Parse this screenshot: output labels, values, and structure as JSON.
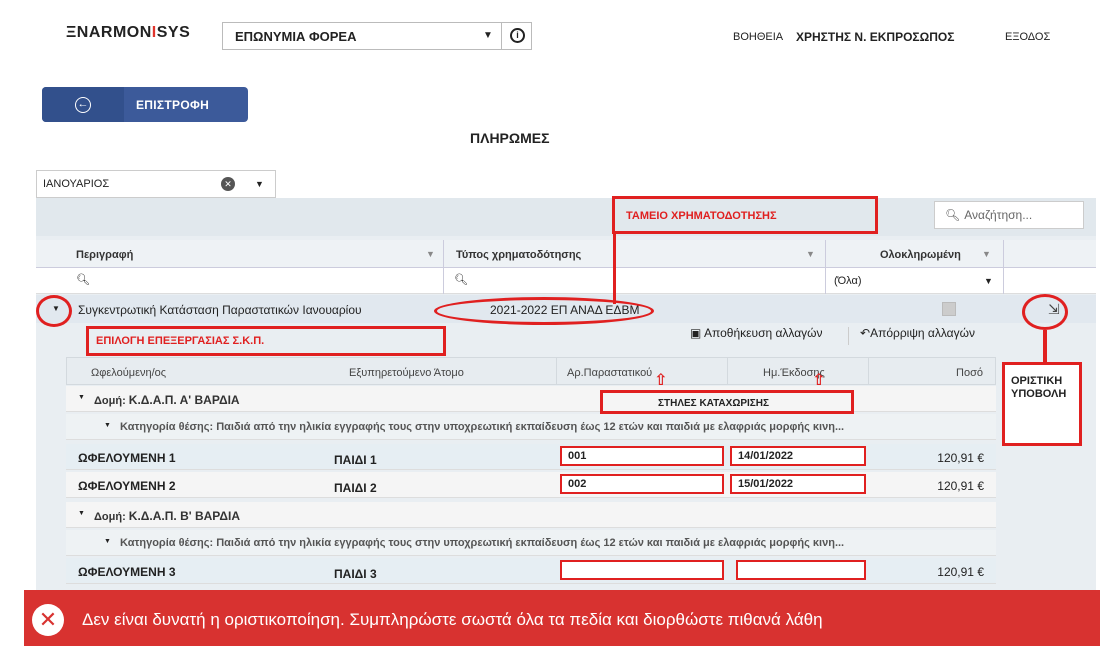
{
  "header": {
    "logo_pre": "ΞNARMON",
    "logo_o": "I",
    "logo_post": "SYS",
    "org_selector": "ΕΠΩΝΥΜΙΑ ΦΟΡΕΑ",
    "help": "ΒΟΗΘΕΙΑ",
    "user": "ΧΡΗΣΤΗΣ Ν. ΕΚΠΡΟΣΩΠΟΣ",
    "exit": "ΕΞΟΔΟΣ"
  },
  "back_button": {
    "label": "ΕΠΙΣΤΡΟΦΗ"
  },
  "page_title": "ΠΛΗΡΩΜΕΣ",
  "month_select": {
    "value": "ΙΑΝΟΥΑΡΙΟΣ"
  },
  "search": {
    "placeholder": "Αναζήτηση..."
  },
  "grid": {
    "columns": {
      "description": "Περιγραφή",
      "funding_type": "Τύπος χρηματοδότησης",
      "completed": "Ολοκληρωμένη"
    },
    "filter_all": "(Όλα)",
    "master_row": {
      "description": "Συγκεντρωτική Κατάσταση Παραστατικών Ιανουαρίου",
      "funding": "2021-2022 ΕΠ ΑΝΑΔ ΕΔΒΜ"
    }
  },
  "detail": {
    "save": "Αποθήκευση αλλαγών",
    "discard": "Απόρριψη αλλαγών",
    "columns": [
      "Ωφελούμενη/ος",
      "Εξυπηρετούμενο Άτομο",
      "Αρ.Παραστατικού",
      "Ημ.Έκδοσης",
      "Ποσό"
    ],
    "group1": {
      "prefix": "Δομή: ",
      "name": "Κ.Δ.Α.Π. Α' ΒΑΡΔΙΑ"
    },
    "group2": {
      "prefix": "Δομή: ",
      "name": "Κ.Δ.Α.Π. Β' ΒΑΡΔΙΑ"
    },
    "category": "Κατηγορία θέσης: Παιδιά από την ηλικία εγγραφής τους στην υποχρεωτική εκπαίδευση έως 12 ετών και παιδιά με ελαφριάς μορφής κινη...",
    "rows": [
      {
        "beneficiary": "ΩΦΕΛΟΥΜΕΝΗ 1",
        "person": "ΠΑΙΔΙ 1",
        "doc_no": "001",
        "date": "14/01/2022",
        "amount": "120,91 €"
      },
      {
        "beneficiary": "ΩΦΕΛΟΥΜΕΝΗ 2",
        "person": "ΠΑΙΔΙ 2",
        "doc_no": "002",
        "date": "15/01/2022",
        "amount": "120,91 €"
      },
      {
        "beneficiary": "ΩΦΕΛΟΥΜΕΝΗ 3",
        "person": "ΠΑΙΔΙ 3",
        "doc_no": "",
        "date": "",
        "amount": "120,91 €"
      }
    ]
  },
  "annotations": {
    "funding_fund": "ΤΑΜΕΙΟ ΧΡΗΜΑΤΟΔΟΤΗΣΗΣ",
    "edit_choice": "ΕΠΙΛΟΓΗ ΕΠΕΞΕΡΓΑΣΙΑΣ Σ.Κ.Π.",
    "entry_columns": "ΣΤΗΛΕΣ ΚΑΤΑΧΩΡΙΣΗΣ",
    "final_submit_line1": "ΟΡΙΣΤΙΚΗ",
    "final_submit_line2": "ΥΠΟΒΟΛΗ"
  },
  "error_banner": {
    "message": "Δεν είναι δυνατή η οριστικοποίηση. Συμπληρώστε σωστά όλα τα πεδία και διορθώστε πιθανά λάθη"
  },
  "colors": {
    "accent": "#3c5a9a",
    "annotation_red": "#e02020",
    "error_bg": "#d83230"
  }
}
